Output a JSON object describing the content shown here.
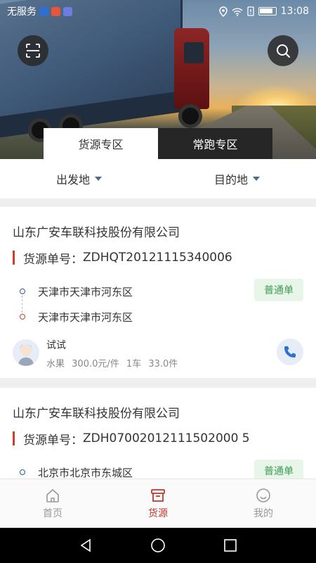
{
  "status_bar": {
    "carrier": "无服务",
    "time": "13:08"
  },
  "tabs": [
    {
      "label": "货源专区",
      "active": true
    },
    {
      "label": "常跑专区",
      "active": false
    }
  ],
  "filters": {
    "origin": "出发地",
    "destination": "目的地"
  },
  "cards": [
    {
      "company": "山东广安车联科技股份有限公司",
      "order_label": "货源单号：",
      "order_no": "ZDHQT20121115340006",
      "from": "天津市天津市河东区",
      "to": "天津市天津市河东区",
      "badge": "普通单",
      "person": "试试",
      "cargo": {
        "name": "水果",
        "price": "300.0元/件",
        "trucks": "1车",
        "weight": "33.0件"
      }
    },
    {
      "company": "山东广安车联科技股份有限公司",
      "order_label": "货源单号：",
      "order_no": "ZDH07002012111502000 5",
      "from": "北京市北京市东城区",
      "badge": "普通单"
    }
  ],
  "bottom_nav": [
    {
      "label": "首页",
      "icon": "home-icon",
      "active": false
    },
    {
      "label": "货源",
      "icon": "cargo-box-icon",
      "active": true
    },
    {
      "label": "我的",
      "icon": "profile-icon",
      "active": false
    }
  ],
  "colors": {
    "accent": "#c0392b",
    "badge_bg": "#e7f6e9",
    "badge_text": "#3f9b52",
    "tab_dark": "#262626"
  }
}
